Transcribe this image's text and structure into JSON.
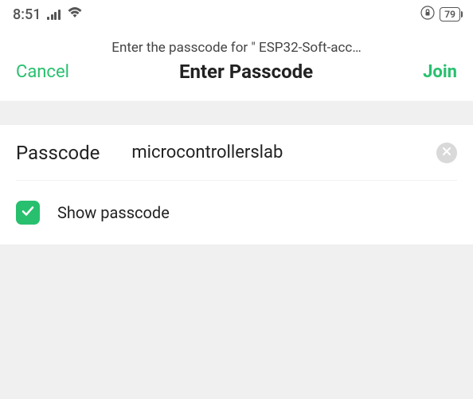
{
  "status": {
    "time": "8:51",
    "battery": "79"
  },
  "header": {
    "subtitle": "Enter the passcode for \" ESP32-Soft-acc…",
    "cancel": "Cancel",
    "title": "Enter Passcode",
    "join": "Join"
  },
  "form": {
    "passcode_label": "Passcode",
    "passcode_value": "microcontrollerslab",
    "show_label": "Show passcode",
    "show_checked": true
  },
  "colors": {
    "accent": "#28c06e"
  }
}
